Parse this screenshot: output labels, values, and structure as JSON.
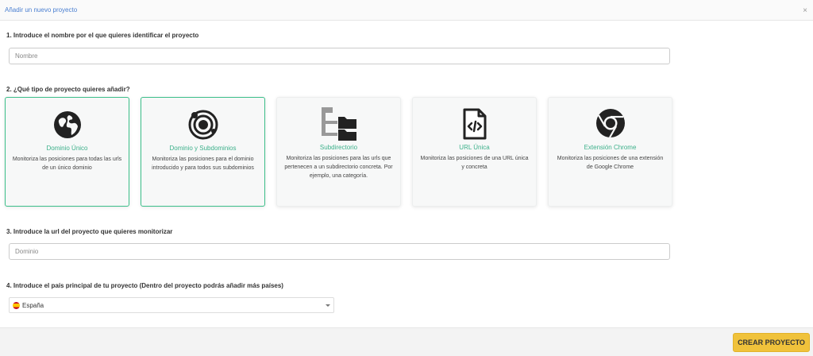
{
  "header": {
    "title": "Añadir un nuevo proyecto",
    "close_icon": "×"
  },
  "step1": {
    "label": "1. Introduce el nombre por el que quieres identificar el proyecto",
    "placeholder": "Nombre",
    "value": ""
  },
  "step2": {
    "label": "2. ¿Qué tipo de proyecto quieres añadir?",
    "cards": [
      {
        "title": "Dominio Único",
        "description": "Monitoriza las posiciones para todas las urls de un único dominio",
        "icon": "globe-icon",
        "selected": true
      },
      {
        "title": "Dominio y Subdominios",
        "description": "Monitoriza las posiciones para el dominio introducido y para todos sus subdominios",
        "icon": "orbit-icon",
        "selected": true
      },
      {
        "title": "Subdirectorio",
        "description": "Monitoriza las posiciones para las urls que pertenecen a un subdirectorio concreta. Por ejemplo, una categoría.",
        "icon": "folder-tree-icon",
        "selected": false
      },
      {
        "title": "URL Única",
        "description": "Monitoriza las posiciones de una URL única y concreta",
        "icon": "code-file-icon",
        "selected": false
      },
      {
        "title": "Extensión Chrome",
        "description": "Monitoriza las posiciones de una extensión de Google Chrome",
        "icon": "chrome-icon",
        "selected": false
      }
    ]
  },
  "step3": {
    "label": "3. Introduce la url del proyecto que quieres monitorizar",
    "placeholder": "Dominio",
    "value": ""
  },
  "step4": {
    "label": "4. Introduce el país principal de tu proyecto (Dentro del proyecto podrás añadir más países)",
    "selected": "España"
  },
  "footer": {
    "create_label": "CREAR PROYECTO"
  },
  "colors": {
    "accent": "#3cb08a",
    "button": "#f0c23b",
    "title_link": "#4a7fd1"
  }
}
